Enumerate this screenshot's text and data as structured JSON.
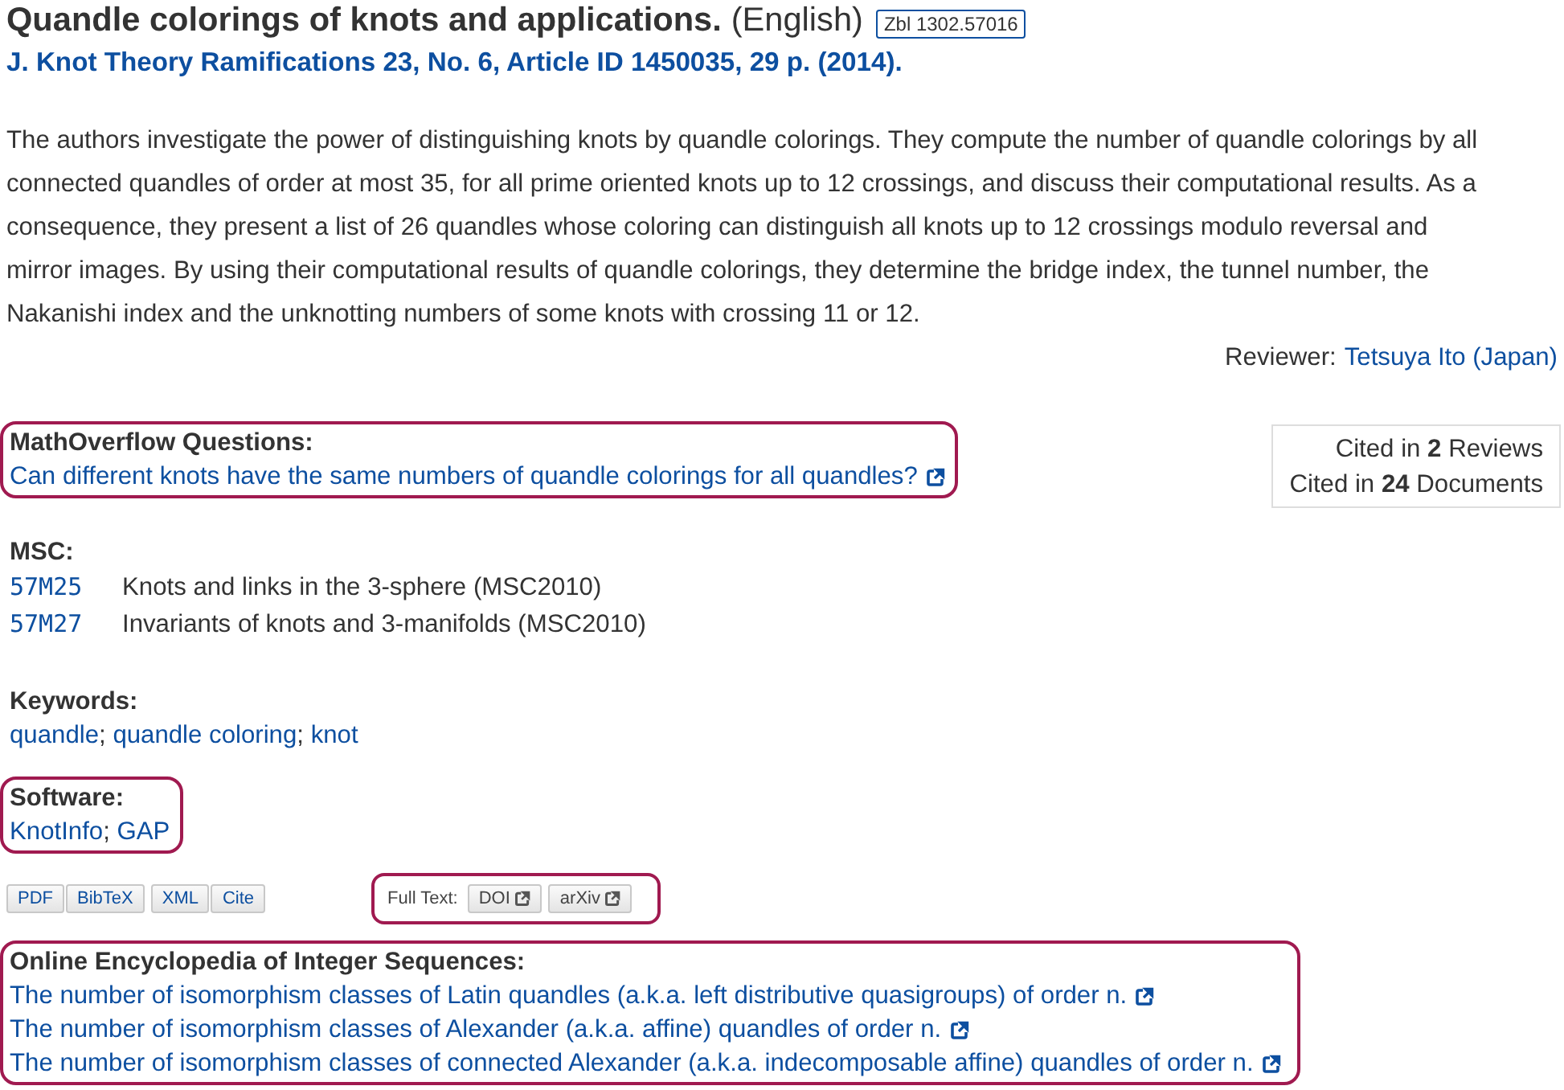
{
  "title": {
    "text": "Quandle colorings of knots and applications.",
    "language": "(English)",
    "zbl": "Zbl 1302.57016"
  },
  "source": "J. Knot Theory Ramifications 23, No. 6, Article ID 1450035, 29 p. (2014).",
  "abstract": "The authors investigate the power of distinguishing knots by quandle colorings. They compute the number of quandle colorings by all connected quandles of order at most 35, for all prime oriented knots up to 12 crossings, and discuss their computational results. As a consequence, they present a list of 26 quandles whose coloring can distinguish all knots up to 12 crossings modulo reversal and mirror images. By using their computational results of quandle colorings, they determine the bridge index, the tunnel number, the Nakanishi index and the unknotting numbers of some knots with crossing 11 or 12.",
  "reviewer": {
    "label": "Reviewer:",
    "name": "Tetsuya Ito (Japan)"
  },
  "mathoverflow": {
    "heading": "MathOverflow Questions:",
    "highlighted": true,
    "links": [
      "Can different knots have the same numbers of quandle colorings for all quandles?"
    ]
  },
  "cited": [
    "Cited in **2** Reviews",
    "Cited in **24** Documents"
  ],
  "msc": {
    "heading": "MSC:",
    "rows": [
      {
        "code": "57M25",
        "text": "Knots and links in the 3-sphere (MSC2010)"
      },
      {
        "code": "57M27",
        "text": "Invariants of knots and 3-manifolds (MSC2010)"
      }
    ]
  },
  "keywords": {
    "heading": "Keywords:",
    "items": [
      {
        "label": "quandle",
        "suffix": ";"
      },
      {
        "label": "quandle coloring",
        "suffix": ";"
      },
      {
        "label": "knot"
      }
    ]
  },
  "software": {
    "heading": "Software:",
    "highlighted": true,
    "items": [
      {
        "label": "KnotInfo",
        "suffix": ";"
      },
      {
        "label": "GAP"
      }
    ]
  },
  "export_buttons": [
    [
      "PDF",
      "BibTeX"
    ],
    [
      "XML",
      "Cite"
    ]
  ],
  "full_text": {
    "label": "Full Text:",
    "highlighted": true,
    "buttons": [
      "DOI",
      "arXiv"
    ]
  },
  "oeis": {
    "heading": "Online Encyclopedia of Integer Sequences:",
    "highlighted": true,
    "links": [
      "The number of isomorphism classes of Latin quandles (a.k.a. left distributive quasigroups) of order n.",
      "The number of isomorphism classes of Alexander (a.k.a. affine) quandles of order n.",
      "The number of isomorphism classes of connected Alexander (a.k.a. indecomposable affine) quandles of order n."
    ]
  }
}
